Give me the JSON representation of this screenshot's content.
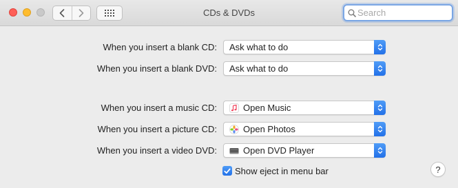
{
  "window": {
    "title": "CDs & DVDs",
    "search_placeholder": "Search",
    "search_value": ""
  },
  "settings": [
    {
      "label": "When you insert a blank CD:",
      "value": "Ask what to do",
      "icon": null
    },
    {
      "label": "When you insert a blank DVD:",
      "value": "Ask what to do",
      "icon": null
    },
    {
      "label": "When you insert a music CD:",
      "value": "Open Music",
      "icon": "music-app-icon"
    },
    {
      "label": "When you insert a picture CD:",
      "value": "Open Photos",
      "icon": "photos-app-icon"
    },
    {
      "label": "When you insert a video DVD:",
      "value": "Open DVD Player",
      "icon": "dvd-player-app-icon"
    }
  ],
  "eject": {
    "label": "Show eject in menu bar",
    "checked": true
  },
  "help_label": "?",
  "colors": {
    "accent": "#2f7bf0",
    "close": "#fe5f57",
    "minimize": "#febc2e"
  }
}
